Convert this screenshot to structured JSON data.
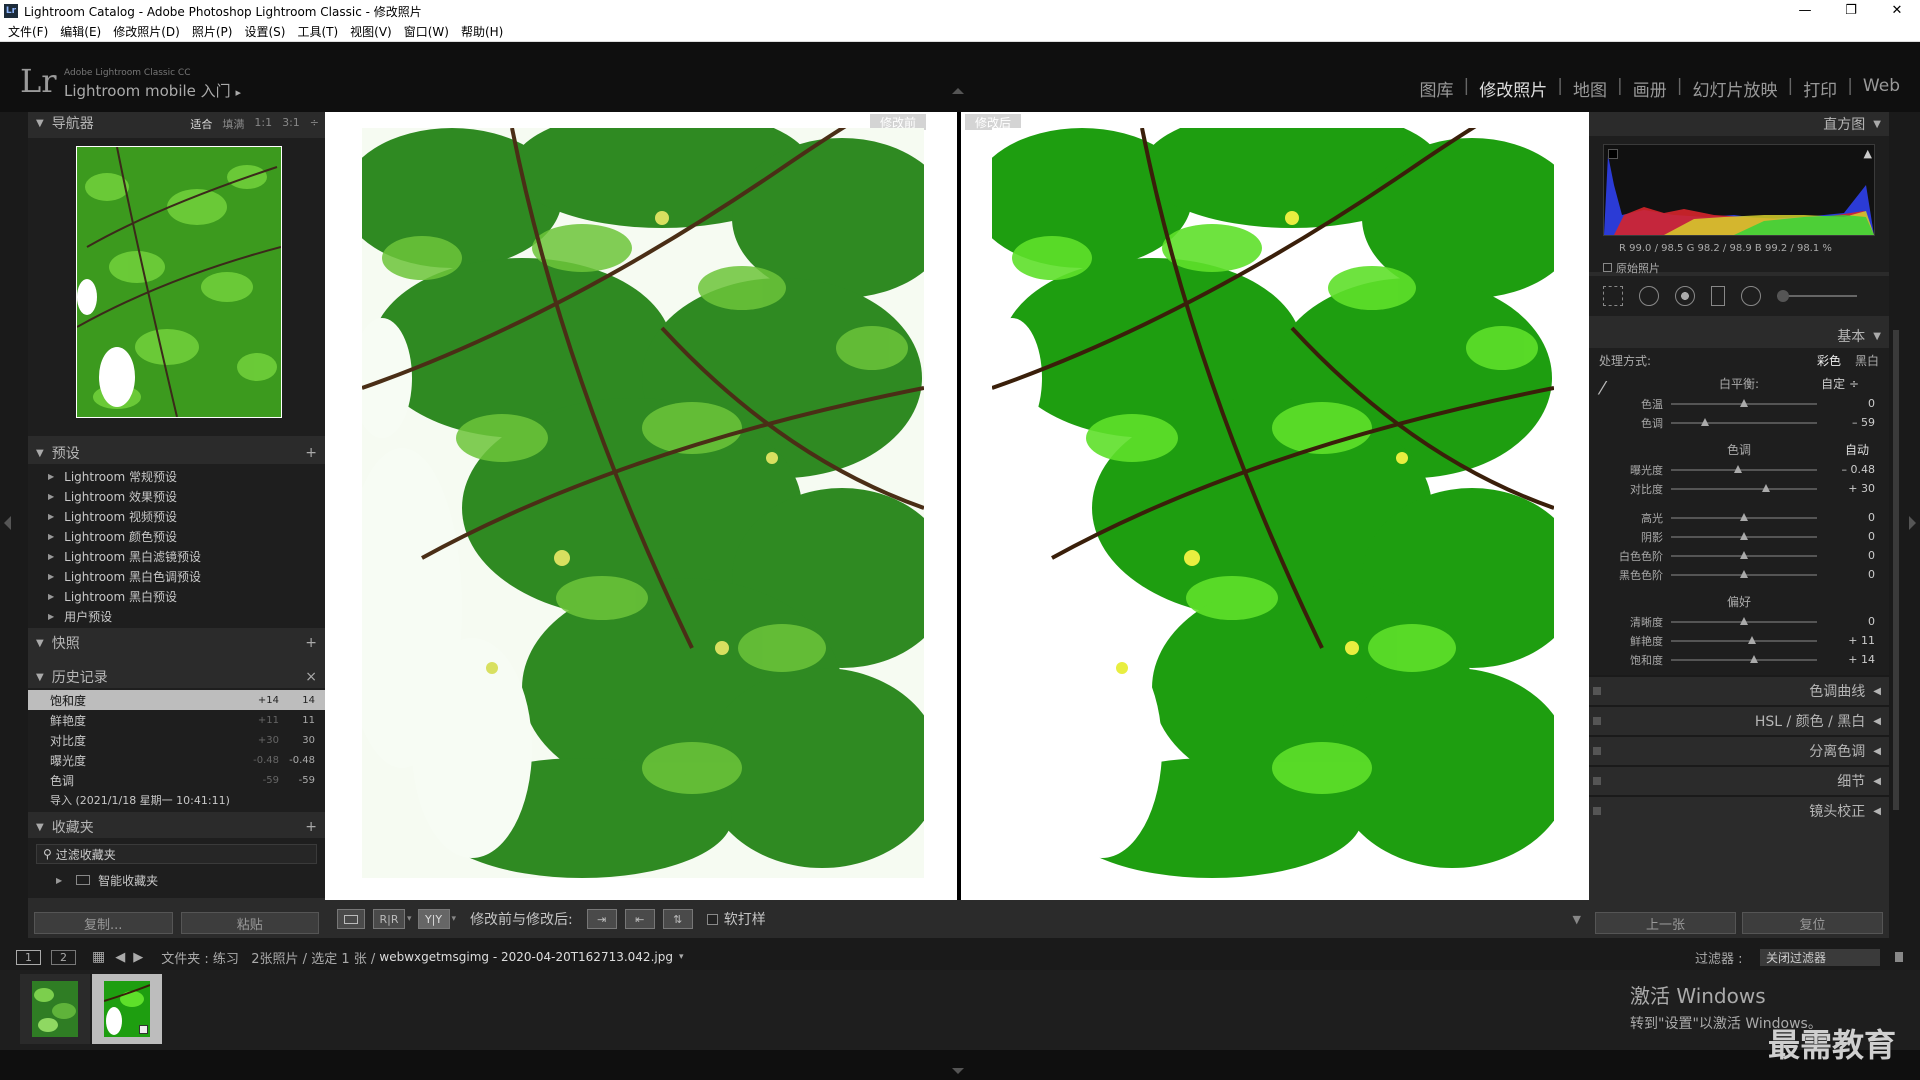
{
  "window": {
    "title": "Lightroom Catalog - Adobe Photoshop Lightroom Classic - 修改照片",
    "app_icon": "Lr",
    "controls": [
      "—",
      "❐",
      "✕"
    ]
  },
  "menu": [
    "文件(F)",
    "编辑(E)",
    "修改照片(D)",
    "照片(P)",
    "设置(S)",
    "工具(T)",
    "视图(V)",
    "窗口(W)",
    "帮助(H)"
  ],
  "header": {
    "logo": "Lr",
    "product_line": "Adobe Lightroom Classic CC",
    "identity": "Lightroom mobile 入门",
    "identity_arrow": "▸",
    "modules": [
      {
        "label": "图库"
      },
      {
        "label": "修改照片",
        "active": true
      },
      {
        "label": "地图"
      },
      {
        "label": "画册"
      },
      {
        "label": "幻灯片放映"
      },
      {
        "label": "打印"
      },
      {
        "label": "Web"
      }
    ]
  },
  "left": {
    "navigator": {
      "title": "导航器",
      "opts": [
        "适合",
        "填满",
        "1:1",
        "3:1"
      ],
      "opts_more": "÷"
    },
    "presets": {
      "title": "预设",
      "items": [
        "Lightroom 常规预设",
        "Lightroom 效果预设",
        "Lightroom 视频预设",
        "Lightroom 颜色预设",
        "Lightroom 黑白滤镜预设",
        "Lightroom 黑白色调预设",
        "Lightroom 黑白预设",
        "用户预设"
      ]
    },
    "snapshots": {
      "title": "快照"
    },
    "history": {
      "title": "历史记录",
      "close": "×",
      "rows": [
        {
          "label": "饱和度",
          "delta": "+14",
          "value": "14",
          "selected": true
        },
        {
          "label": "鲜艳度",
          "delta": "+11",
          "value": "11"
        },
        {
          "label": "对比度",
          "delta": "+30",
          "value": "30"
        },
        {
          "label": "曝光度",
          "delta": "-0.48",
          "value": "-0.48"
        },
        {
          "label": "色调",
          "delta": "-59",
          "value": "-59"
        },
        {
          "label": "导入 (2021/1/18 星期一 10:41:11)",
          "delta": "",
          "value": ""
        }
      ]
    },
    "collections": {
      "title": "收藏夹",
      "filter": "过滤收藏夹",
      "smart": "智能收藏夹"
    },
    "buttons": {
      "copy": "复制...",
      "paste": "粘贴"
    }
  },
  "center": {
    "before_label": "修改前",
    "after_label": "修改后"
  },
  "toolbar": {
    "view_label": "修改前与修改后:",
    "softproof": "软打样",
    "rr": "R|R",
    "yy": "Y|Y"
  },
  "right": {
    "histogram": {
      "title": "直方图",
      "readout": "R  99.0 / 98.5   G  98.2 / 98.9   B  99.2 / 98.1  %",
      "original": "原始照片"
    },
    "basic": {
      "title": "基本",
      "process_label": "处理方式:",
      "color": "彩色",
      "bw": "黑白",
      "wb_label": "白平衡:",
      "wb_value": "自定 ÷",
      "tone_label": "色调",
      "auto": "自动",
      "presence_label": "偏好",
      "sliders_wb": [
        {
          "label": "色温",
          "value": "0",
          "pos": 0.5
        },
        {
          "label": "色调",
          "value": "– 59",
          "pos": 0.23
        }
      ],
      "sliders_tone": [
        {
          "label": "曝光度",
          "value": "– 0.48",
          "pos": 0.46
        },
        {
          "label": "对比度",
          "value": "+ 30",
          "pos": 0.65
        }
      ],
      "sliders_tone2": [
        {
          "label": "高光",
          "value": "0",
          "pos": 0.5
        },
        {
          "label": "阴影",
          "value": "0",
          "pos": 0.5
        },
        {
          "label": "白色色阶",
          "value": "0",
          "pos": 0.5
        },
        {
          "label": "黑色色阶",
          "value": "0",
          "pos": 0.5
        }
      ],
      "sliders_presence": [
        {
          "label": "清晰度",
          "value": "0",
          "pos": 0.5
        },
        {
          "label": "鲜艳度",
          "value": "+ 11",
          "pos": 0.555
        },
        {
          "label": "饱和度",
          "value": "+ 14",
          "pos": 0.57
        }
      ]
    },
    "collapsed": [
      "色调曲线",
      "HSL / 颜色 / 黑白",
      "分离色调",
      "细节",
      "镜头校正"
    ],
    "buttons": {
      "prev": "上一张",
      "reset": "复位"
    }
  },
  "filmstrip_bar": {
    "page1": "1",
    "page2": "2",
    "path": "文件夹 : 练习   2张照片 / 选定 1 张 / ",
    "filename": "webwxgetmsgimg - 2020-04-20T162713.042.jpg",
    "filter_label": "过滤器 :",
    "filter_value": "关闭过滤器"
  },
  "overlay": {
    "activate": "激活 Windows",
    "activate_sub": "转到\"设置\"以激活 Windows。",
    "watermark": "最需教育"
  }
}
